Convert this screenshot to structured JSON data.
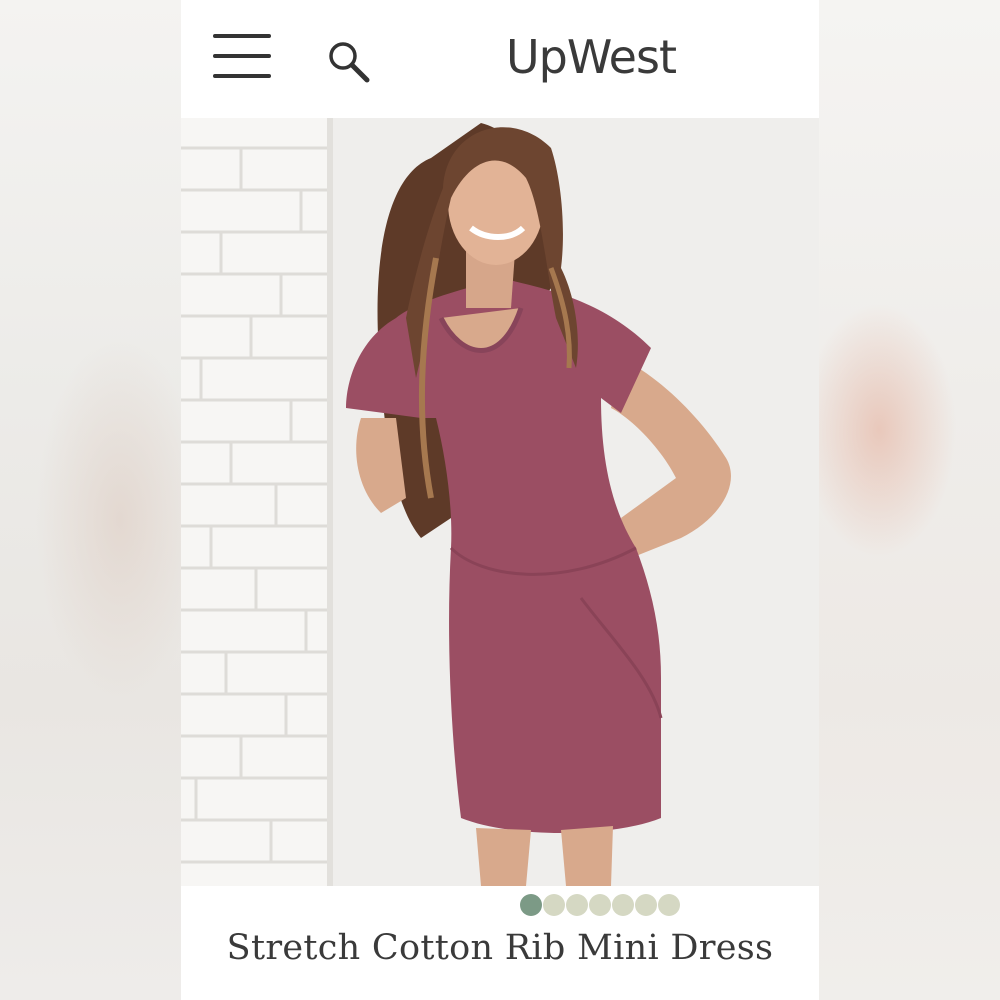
{
  "header": {
    "brand": "UpWest",
    "menu_icon": "hamburger-menu-icon",
    "search_icon": "search-icon"
  },
  "product": {
    "title": "Stretch Cotton Rib Mini Dress",
    "image_alt": "Model wearing rose-colored ribbed mini dress",
    "color_swatches": [
      {
        "name": "swatch-1",
        "color": "#7c9a86",
        "selected": true
      },
      {
        "name": "swatch-2",
        "color": "#d5d8c3",
        "selected": false
      },
      {
        "name": "swatch-3",
        "color": "#d5d8c3",
        "selected": false
      },
      {
        "name": "swatch-4",
        "color": "#d5d8c3",
        "selected": false
      },
      {
        "name": "swatch-5",
        "color": "#d5d8c3",
        "selected": false
      },
      {
        "name": "swatch-6",
        "color": "#d5d8c3",
        "selected": false
      },
      {
        "name": "swatch-7",
        "color": "#d5d8c3",
        "selected": false
      }
    ],
    "dress_color": "#9b4e63"
  }
}
